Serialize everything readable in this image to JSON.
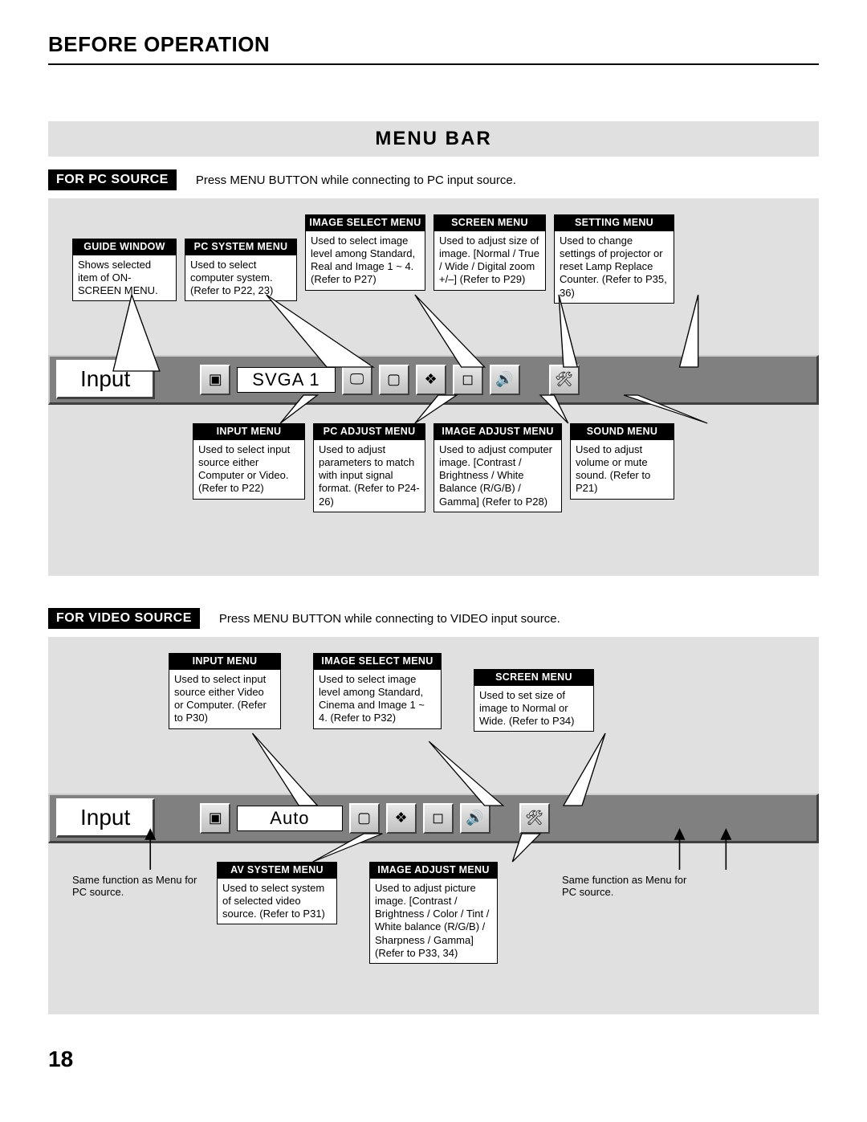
{
  "page_title": "BEFORE OPERATION",
  "section_title": "MENU BAR",
  "page_number": "18",
  "pc": {
    "label": "FOR PC SOURCE",
    "instruction": "Press MENU BUTTON while connecting to PC input source.",
    "menubar_label": "Input",
    "menubar_mode": "SVGA 1",
    "top": [
      {
        "title": "GUIDE WINDOW",
        "body": "Shows selected item of ON-SCREEN MENU."
      },
      {
        "title": "PC SYSTEM MENU",
        "body": "Used to select computer system. (Refer to P22, 23)"
      },
      {
        "title": "IMAGE SELECT MENU",
        "body": "Used to select image level among Standard, Real and Image 1 ~ 4. (Refer to P27)"
      },
      {
        "title": "SCREEN MENU",
        "body": "Used to adjust size of image.  [Normal / True / Wide / Digital zoom +/–] (Refer to P29)"
      },
      {
        "title": "SETTING MENU",
        "body": "Used to change settings of projector or reset Lamp Replace Counter. (Refer to P35, 36)"
      }
    ],
    "bottom": [
      {
        "title": "INPUT MENU",
        "body": "Used to select input source either Computer or Video. (Refer to P22)"
      },
      {
        "title": "PC ADJUST MENU",
        "body": "Used to adjust parameters to match with input signal format. (Refer to P24-26)"
      },
      {
        "title": "IMAGE ADJUST MENU",
        "body": "Used to adjust computer image. [Contrast / Brightness / White Balance (R/G/B) / Gamma] (Refer to P28)"
      },
      {
        "title": "SOUND MENU",
        "body": "Used to adjust volume or mute sound. (Refer to P21)"
      }
    ]
  },
  "video": {
    "label": "FOR VIDEO SOURCE",
    "instruction": "Press MENU BUTTON while connecting to VIDEO input source.",
    "menubar_label": "Input",
    "menubar_mode": "Auto",
    "top": [
      {
        "title": "INPUT MENU",
        "body": "Used to select input source either Video or Computer. (Refer to P30)"
      },
      {
        "title": "IMAGE SELECT MENU",
        "body": "Used to select image level among Standard, Cinema and Image 1 ~ 4. (Refer to P32)"
      },
      {
        "title": "SCREEN MENU",
        "body": "Used to set size of image to Normal or Wide. (Refer to P34)"
      }
    ],
    "bottom": [
      {
        "title": "AV SYSTEM MENU",
        "body": "Used to select system of selected video source. (Refer to P31)"
      },
      {
        "title": "IMAGE ADJUST MENU",
        "body": "Used to adjust picture image. [Contrast / Brightness / Color / Tint / White balance (R/G/B) / Sharpness / Gamma] (Refer to P33, 34)"
      }
    ],
    "note_left": "Same function as Menu for PC source.",
    "note_right": "Same function as Menu for PC source."
  }
}
